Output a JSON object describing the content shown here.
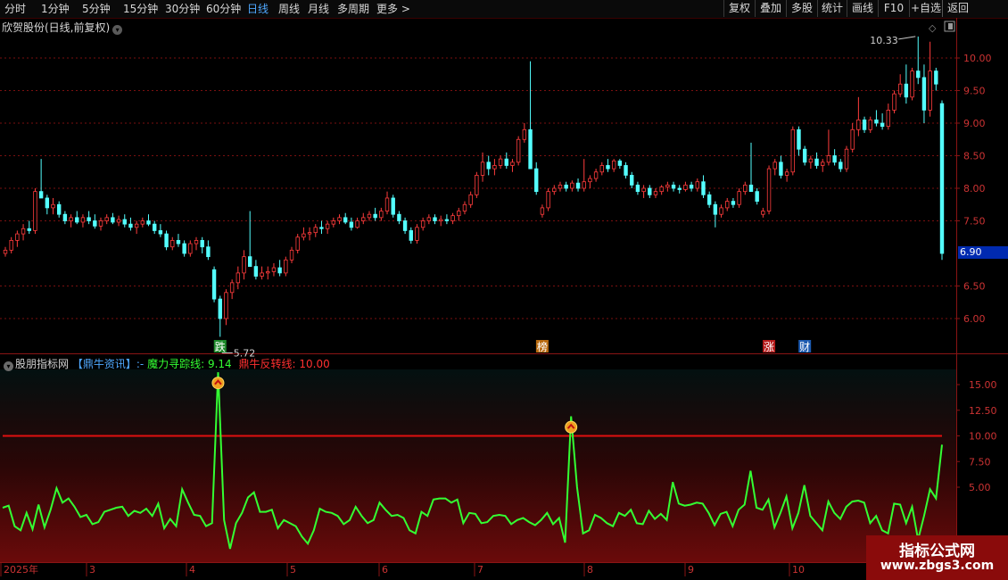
{
  "toolbar": {
    "periods": [
      "分时",
      "1分钟",
      "5分钟",
      "15分钟",
      "30分钟",
      "60分钟",
      "日线",
      "周线",
      "月线",
      "多周期",
      "更多 >"
    ],
    "active_period": "日线",
    "right_buttons": [
      "复权",
      "叠加",
      "多股",
      "统计",
      "画线",
      "F10",
      "+自选",
      "返回"
    ]
  },
  "main_chart": {
    "title": "欣贺股份(日线,前复权)",
    "y_ticks": [
      "10.00",
      "9.50",
      "9.00",
      "8.50",
      "8.00",
      "7.50",
      "6.50",
      "6.00"
    ],
    "current_price_label": "6.90",
    "high_annotation": "10.33",
    "low_annotation": "5.72",
    "markers": [
      {
        "text": "跌",
        "color": "#1e8a2a"
      },
      {
        "text": "榜",
        "color": "#b86a10"
      },
      {
        "text": "涨",
        "color": "#b51a1a"
      },
      {
        "text": "财",
        "color": "#1c5ab0"
      }
    ]
  },
  "indicator": {
    "source": "股朋指标网",
    "tag": "【鼎牛资讯】",
    "tag_suffix": ":-",
    "line1_label": "魔力寻踪线:",
    "line1_value": "9.14",
    "line2_label": "鼎牛反转线:",
    "line2_value": "10.00",
    "y_ticks": [
      "15.00",
      "12.50",
      "10.00",
      "7.50",
      "5.00"
    ]
  },
  "x_axis": {
    "labels": [
      "2025年",
      "3",
      "4",
      "5",
      "6",
      "7",
      "8",
      "9",
      "10"
    ]
  },
  "watermark": {
    "line1": "指标公式网",
    "line2": "www.zbgs3.com"
  },
  "colors": {
    "up": "#ff3c3c",
    "down": "#54ffff",
    "grid": "#7a1010",
    "magic_line": "#33ff33",
    "reversal_line": "#e01010",
    "active_tab": "#4fa8ff"
  },
  "chart_data": [
    {
      "type": "candlestick",
      "title": "欣贺股份(日线,前复权)",
      "ylim": [
        5.6,
        10.5
      ],
      "ohlc": [
        [
          7.0,
          7.1,
          6.95,
          7.05
        ],
        [
          7.05,
          7.25,
          7.0,
          7.2
        ],
        [
          7.2,
          7.35,
          7.1,
          7.3
        ],
        [
          7.3,
          7.45,
          7.2,
          7.38
        ],
        [
          7.38,
          7.5,
          7.3,
          7.35
        ],
        [
          7.35,
          8.0,
          7.3,
          7.95
        ],
        [
          7.95,
          8.45,
          7.9,
          7.85
        ],
        [
          7.85,
          7.9,
          7.6,
          7.7
        ],
        [
          7.7,
          7.85,
          7.6,
          7.75
        ],
        [
          7.75,
          7.8,
          7.55,
          7.6
        ],
        [
          7.6,
          7.65,
          7.45,
          7.5
        ],
        [
          7.5,
          7.6,
          7.4,
          7.55
        ],
        [
          7.55,
          7.65,
          7.45,
          7.48
        ],
        [
          7.48,
          7.6,
          7.4,
          7.55
        ],
        [
          7.55,
          7.65,
          7.45,
          7.5
        ],
        [
          7.5,
          7.6,
          7.38,
          7.42
        ],
        [
          7.42,
          7.55,
          7.35,
          7.5
        ],
        [
          7.5,
          7.6,
          7.45,
          7.55
        ],
        [
          7.55,
          7.62,
          7.45,
          7.48
        ],
        [
          7.48,
          7.58,
          7.42,
          7.52
        ],
        [
          7.52,
          7.6,
          7.4,
          7.45
        ],
        [
          7.45,
          7.55,
          7.35,
          7.4
        ],
        [
          7.4,
          7.5,
          7.3,
          7.45
        ],
        [
          7.45,
          7.55,
          7.4,
          7.5
        ],
        [
          7.5,
          7.6,
          7.42,
          7.45
        ],
        [
          7.45,
          7.5,
          7.3,
          7.35
        ],
        [
          7.35,
          7.45,
          7.25,
          7.3
        ],
        [
          7.3,
          7.35,
          7.05,
          7.1
        ],
        [
          7.1,
          7.25,
          7.05,
          7.2
        ],
        [
          7.2,
          7.3,
          7.1,
          7.15
        ],
        [
          7.15,
          7.2,
          6.95,
          7.0
        ],
        [
          7.0,
          7.2,
          6.95,
          7.15
        ],
        [
          7.15,
          7.25,
          7.05,
          7.2
        ],
        [
          7.2,
          7.25,
          7.0,
          7.1
        ],
        [
          7.1,
          7.2,
          6.9,
          6.95
        ],
        [
          6.75,
          6.8,
          6.25,
          6.3
        ],
        [
          6.3,
          6.35,
          5.72,
          6.0
        ],
        [
          6.0,
          6.45,
          5.9,
          6.4
        ],
        [
          6.4,
          6.6,
          6.3,
          6.55
        ],
        [
          6.55,
          6.8,
          6.45,
          6.7
        ],
        [
          6.7,
          7.05,
          6.6,
          6.95
        ],
        [
          6.95,
          7.65,
          6.9,
          6.8
        ],
        [
          6.8,
          6.9,
          6.6,
          6.65
        ],
        [
          6.65,
          6.8,
          6.6,
          6.7
        ],
        [
          6.7,
          6.8,
          6.6,
          6.72
        ],
        [
          6.72,
          6.85,
          6.65,
          6.78
        ],
        [
          6.78,
          6.9,
          6.65,
          6.7
        ],
        [
          6.7,
          6.95,
          6.65,
          6.9
        ],
        [
          6.9,
          7.1,
          6.85,
          7.05
        ],
        [
          7.05,
          7.3,
          7.0,
          7.25
        ],
        [
          7.25,
          7.4,
          7.2,
          7.3
        ],
        [
          7.3,
          7.4,
          7.2,
          7.32
        ],
        [
          7.32,
          7.45,
          7.25,
          7.4
        ],
        [
          7.4,
          7.5,
          7.3,
          7.38
        ],
        [
          7.38,
          7.5,
          7.3,
          7.45
        ],
        [
          7.45,
          7.55,
          7.4,
          7.5
        ],
        [
          7.5,
          7.6,
          7.45,
          7.55
        ],
        [
          7.55,
          7.62,
          7.45,
          7.48
        ],
        [
          7.48,
          7.55,
          7.35,
          7.4
        ],
        [
          7.4,
          7.55,
          7.38,
          7.5
        ],
        [
          7.5,
          7.62,
          7.45,
          7.55
        ],
        [
          7.55,
          7.65,
          7.5,
          7.6
        ],
        [
          7.6,
          7.7,
          7.5,
          7.55
        ],
        [
          7.55,
          7.7,
          7.5,
          7.65
        ],
        [
          7.65,
          7.95,
          7.6,
          7.85
        ],
        [
          7.85,
          7.9,
          7.55,
          7.6
        ],
        [
          7.6,
          7.65,
          7.45,
          7.5
        ],
        [
          7.5,
          7.55,
          7.3,
          7.35
        ],
        [
          7.35,
          7.4,
          7.15,
          7.2
        ],
        [
          7.2,
          7.45,
          7.15,
          7.4
        ],
        [
          7.4,
          7.55,
          7.35,
          7.5
        ],
        [
          7.5,
          7.6,
          7.45,
          7.55
        ],
        [
          7.55,
          7.6,
          7.45,
          7.5
        ],
        [
          7.5,
          7.58,
          7.42,
          7.52
        ],
        [
          7.52,
          7.6,
          7.45,
          7.5
        ],
        [
          7.5,
          7.62,
          7.45,
          7.58
        ],
        [
          7.58,
          7.7,
          7.5,
          7.65
        ],
        [
          7.65,
          7.8,
          7.6,
          7.75
        ],
        [
          7.75,
          7.95,
          7.7,
          7.9
        ],
        [
          7.9,
          8.25,
          7.85,
          8.2
        ],
        [
          8.2,
          8.55,
          8.1,
          8.4
        ],
        [
          8.4,
          8.5,
          8.2,
          8.3
        ],
        [
          8.3,
          8.45,
          8.2,
          8.35
        ],
        [
          8.35,
          8.5,
          8.3,
          8.45
        ],
        [
          8.45,
          8.55,
          8.3,
          8.35
        ],
        [
          8.35,
          8.45,
          8.25,
          8.4
        ],
        [
          8.4,
          8.8,
          8.35,
          8.75
        ],
        [
          8.75,
          9.0,
          8.7,
          8.9
        ],
        [
          8.9,
          9.95,
          8.35,
          8.3
        ],
        [
          8.3,
          8.4,
          7.9,
          7.95
        ],
        [
          7.6,
          7.75,
          7.55,
          7.7
        ],
        [
          7.7,
          8.0,
          7.65,
          7.95
        ],
        [
          7.95,
          8.05,
          7.9,
          8.0
        ],
        [
          8.0,
          8.1,
          7.95,
          8.05
        ],
        [
          8.05,
          8.1,
          7.95,
          8.0
        ],
        [
          8.0,
          8.12,
          7.95,
          8.08
        ],
        [
          8.08,
          8.15,
          7.95,
          8.0
        ],
        [
          8.0,
          8.45,
          7.95,
          8.1
        ],
        [
          8.1,
          8.2,
          8.0,
          8.15
        ],
        [
          8.15,
          8.3,
          8.1,
          8.25
        ],
        [
          8.25,
          8.4,
          8.2,
          8.35
        ],
        [
          8.35,
          8.45,
          8.25,
          8.3
        ],
        [
          8.3,
          8.45,
          8.25,
          8.42
        ],
        [
          8.42,
          8.45,
          8.3,
          8.35
        ],
        [
          8.35,
          8.4,
          8.15,
          8.2
        ],
        [
          8.2,
          8.25,
          8.0,
          8.05
        ],
        [
          8.05,
          8.1,
          7.9,
          7.95
        ],
        [
          7.95,
          8.05,
          7.85,
          8.0
        ],
        [
          8.0,
          8.05,
          7.85,
          7.9
        ],
        [
          7.9,
          8.0,
          7.85,
          7.95
        ],
        [
          7.95,
          8.05,
          7.9,
          8.02
        ],
        [
          8.02,
          8.1,
          7.95,
          8.05
        ],
        [
          8.05,
          8.1,
          7.95,
          8.0
        ],
        [
          8.0,
          8.05,
          7.92,
          7.98
        ],
        [
          7.98,
          8.1,
          7.95,
          8.05
        ],
        [
          8.05,
          8.1,
          7.95,
          8.0
        ],
        [
          8.0,
          8.15,
          7.95,
          8.1
        ],
        [
          8.1,
          8.2,
          7.85,
          7.9
        ],
        [
          7.9,
          7.95,
          7.7,
          7.75
        ],
        [
          7.75,
          7.8,
          7.4,
          7.6
        ],
        [
          7.6,
          7.75,
          7.55,
          7.7
        ],
        [
          7.7,
          7.85,
          7.65,
          7.8
        ],
        [
          7.8,
          7.85,
          7.7,
          7.75
        ],
        [
          7.75,
          8.0,
          7.7,
          7.95
        ],
        [
          7.95,
          8.1,
          7.9,
          8.05
        ],
        [
          8.05,
          8.7,
          7.95,
          7.95
        ],
        [
          7.95,
          8.0,
          7.75,
          7.8
        ],
        [
          7.6,
          7.7,
          7.55,
          7.65
        ],
        [
          7.65,
          8.35,
          7.6,
          8.3
        ],
        [
          8.3,
          8.45,
          8.2,
          8.4
        ],
        [
          8.4,
          8.5,
          8.15,
          8.2
        ],
        [
          8.2,
          8.3,
          8.1,
          8.25
        ],
        [
          8.25,
          8.95,
          8.2,
          8.9
        ],
        [
          8.9,
          8.95,
          8.5,
          8.6
        ],
        [
          8.6,
          8.65,
          8.35,
          8.4
        ],
        [
          8.4,
          8.5,
          8.3,
          8.45
        ],
        [
          8.45,
          8.55,
          8.3,
          8.35
        ],
        [
          8.35,
          8.45,
          8.25,
          8.4
        ],
        [
          8.4,
          8.9,
          8.35,
          8.5
        ],
        [
          8.5,
          8.6,
          8.35,
          8.4
        ],
        [
          8.4,
          8.45,
          8.25,
          8.3
        ],
        [
          8.3,
          8.65,
          8.25,
          8.6
        ],
        [
          8.6,
          9.0,
          8.55,
          8.9
        ],
        [
          8.9,
          9.4,
          8.8,
          9.05
        ],
        [
          9.05,
          9.1,
          8.85,
          8.9
        ],
        [
          8.9,
          9.1,
          8.85,
          9.05
        ],
        [
          9.05,
          9.2,
          8.95,
          9.0
        ],
        [
          9.0,
          9.15,
          8.9,
          8.95
        ],
        [
          8.95,
          9.3,
          8.9,
          9.2
        ],
        [
          9.2,
          9.5,
          9.15,
          9.45
        ],
        [
          9.45,
          9.75,
          9.4,
          9.6
        ],
        [
          9.6,
          9.9,
          9.3,
          9.4
        ],
        [
          9.4,
          9.85,
          9.35,
          9.8
        ],
        [
          9.8,
          10.33,
          9.6,
          9.7
        ],
        [
          9.7,
          9.9,
          9.0,
          9.2
        ],
        [
          9.2,
          10.25,
          9.1,
          9.8
        ],
        [
          9.8,
          9.85,
          9.5,
          9.6
        ],
        [
          9.3,
          9.35,
          6.9,
          7.0
        ]
      ]
    },
    {
      "type": "line",
      "ylim": [
        -2,
        17
      ],
      "threshold": 10.0,
      "series": [
        {
          "name": "魔力寻踪线",
          "values": [
            3.0,
            3.2,
            1.2,
            0.8,
            2.5,
            0.9,
            3.3,
            1.1,
            2.8,
            4.9,
            3.5,
            3.9,
            3.1,
            2.1,
            2.3,
            1.4,
            1.6,
            2.6,
            2.8,
            3.0,
            3.1,
            2.2,
            2.7,
            2.5,
            2.9,
            2.2,
            3.4,
            1.0,
            1.9,
            1.2,
            4.8,
            3.5,
            2.3,
            2.2,
            1.2,
            1.5,
            16.2,
            1.8,
            -1.0,
            1.5,
            2.5,
            4.0,
            4.5,
            2.6,
            2.6,
            2.8,
            1.0,
            1.8,
            1.5,
            1.2,
            0.2,
            -0.5,
            0.8,
            2.9,
            2.6,
            2.5,
            2.2,
            1.4,
            1.8,
            3.1,
            2.2,
            1.5,
            1.8,
            3.5,
            2.8,
            2.2,
            2.3,
            2.0,
            0.8,
            0.5,
            2.6,
            2.2,
            3.8,
            3.9,
            3.9,
            3.5,
            3.8,
            1.5,
            2.5,
            2.4,
            1.5,
            1.6,
            2.2,
            2.3,
            2.2,
            1.4,
            1.8,
            2.0,
            1.6,
            1.3,
            1.8,
            2.5,
            1.4,
            2.0,
            -0.4,
            11.9,
            5.0,
            0.5,
            0.8,
            2.3,
            2.0,
            1.5,
            1.2,
            2.5,
            2.2,
            2.8,
            1.5,
            1.4,
            2.7,
            1.9,
            2.4,
            1.8,
            5.5,
            3.4,
            3.2,
            3.3,
            3.5,
            3.4,
            2.5,
            1.3,
            2.4,
            2.6,
            1.2,
            2.8,
            3.3,
            6.6,
            3.0,
            2.8,
            3.8,
            1.1,
            2.5,
            4.1,
            1.0,
            2.5,
            5.2,
            2.2,
            1.5,
            0.8,
            3.6,
            2.5,
            1.9,
            3.1,
            3.6,
            3.7,
            3.5,
            1.5,
            2.2,
            0.8,
            0.5,
            3.4,
            3.3,
            1.5,
            3.1,
            -0.1,
            2.2,
            4.8,
            3.9,
            9.14
          ]
        },
        {
          "name": "鼎牛反转线",
          "values": [
            10.0
          ]
        }
      ]
    }
  ]
}
